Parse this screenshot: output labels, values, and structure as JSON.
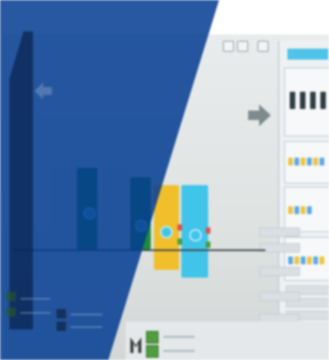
{
  "scene": {
    "description_visible_text": "",
    "colors": {
      "overlay_blue": "#043c91",
      "monitor_bg": "#e3e7e6",
      "cyan": "#41c4ea",
      "yellow": "#f1bf2c",
      "green": "#1f8a3a",
      "dark_blue": "#114c9b"
    },
    "icons": {
      "right_arrow": "arrow-right-icon",
      "left_arrow": "arrow-left-icon",
      "logo": "m-logo-icon"
    }
  }
}
